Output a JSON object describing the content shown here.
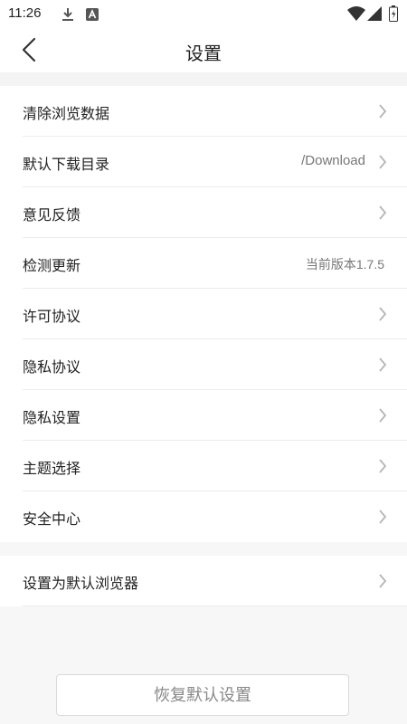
{
  "status_bar": {
    "time": "11:26",
    "icons": [
      "download-icon",
      "text-a-icon",
      "wifi-icon",
      "signal-icon",
      "battery-icon"
    ]
  },
  "header": {
    "title": "设置",
    "back_icon": "back-chevron-icon"
  },
  "settings": {
    "group1": [
      {
        "label": "清除浏览数据",
        "value": "",
        "chevron": true
      },
      {
        "label": "默认下载目录",
        "value": "/Download",
        "chevron": true
      },
      {
        "label": "意见反馈",
        "value": "",
        "chevron": true
      },
      {
        "label": "检测更新",
        "value": "当前版本1.7.5",
        "chevron": false
      },
      {
        "label": "许可协议",
        "value": "",
        "chevron": true
      },
      {
        "label": "隐私协议",
        "value": "",
        "chevron": true
      },
      {
        "label": "隐私设置",
        "value": "",
        "chevron": true
      },
      {
        "label": "主题选择",
        "value": "",
        "chevron": true
      },
      {
        "label": "安全中心",
        "value": "",
        "chevron": true
      }
    ],
    "group2": [
      {
        "label": "设置为默认浏览器",
        "value": "",
        "chevron": true
      }
    ]
  },
  "restore_button": {
    "label": "恢复默认设置"
  },
  "colors": {
    "accent_text": "#222222",
    "secondary_text": "#777777",
    "background": "#f7f7f7"
  }
}
